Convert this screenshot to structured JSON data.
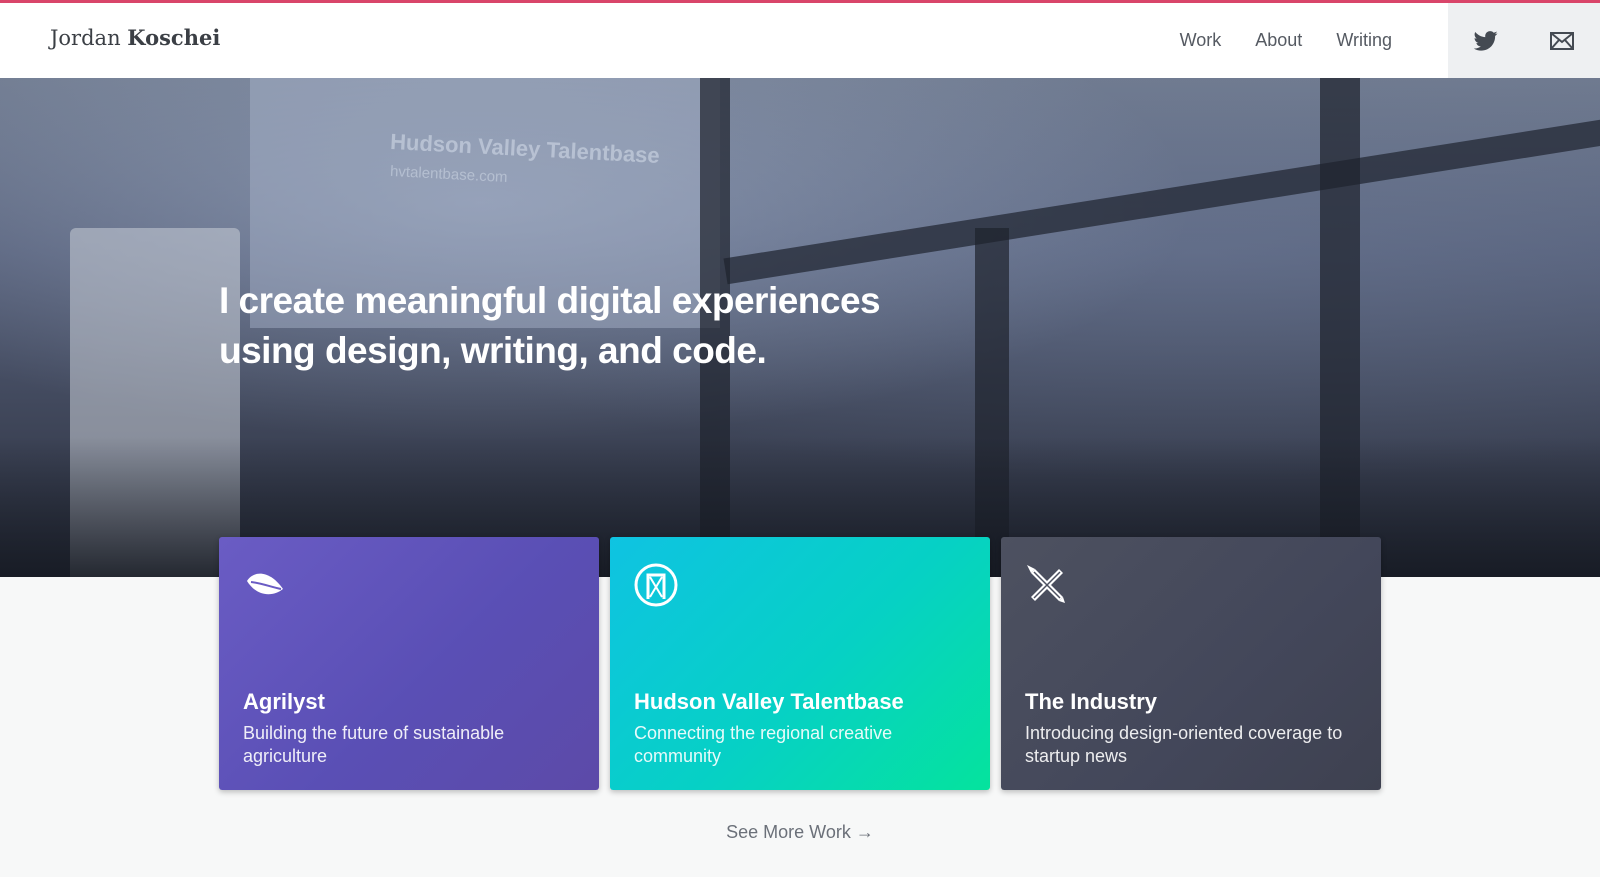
{
  "brand": {
    "first": "Jordan",
    "last": "Koschei"
  },
  "nav": {
    "items": [
      {
        "label": "Work"
      },
      {
        "label": "About"
      },
      {
        "label": "Writing"
      }
    ]
  },
  "social": {
    "twitter_icon": "twitter-bird-icon",
    "email_icon": "envelope-icon"
  },
  "hero": {
    "headline": "I create meaningful digital experiences using design, writing, and code.",
    "screen_title": "Hudson Valley Talentbase",
    "screen_url": "hvtalentbase.com"
  },
  "cards": [
    {
      "title": "Agrilyst",
      "description": "Building the future of sustainable agriculture",
      "icon": "leaf-icon",
      "color": "#6a5cc4"
    },
    {
      "title": "Hudson Valley Talentbase",
      "description": "Connecting the regional creative community",
      "icon": "door-badge-icon",
      "color": "#0fc3e2"
    },
    {
      "title": "The Industry",
      "description": "Introducing design-oriented coverage to startup news",
      "icon": "crossed-pencils-icon",
      "color": "#4d5160"
    }
  ],
  "see_more": {
    "label": "See More Work →"
  },
  "colors": {
    "accent": "#d9456a",
    "text": "#555a62"
  }
}
